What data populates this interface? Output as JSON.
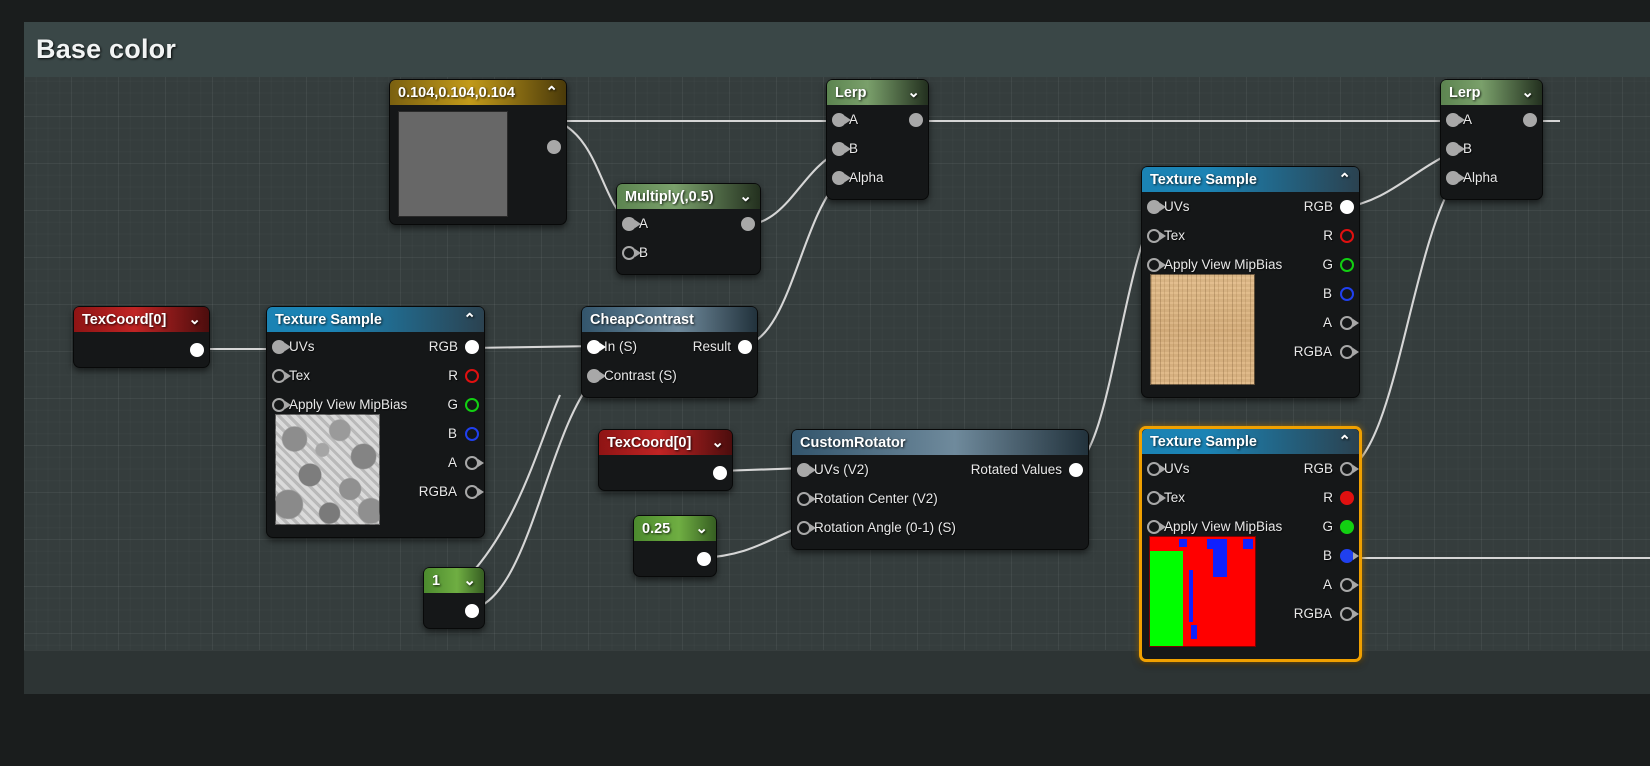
{
  "title_bar": {
    "label": "Base color"
  },
  "colors": {
    "canvas_bg": "#353d3d",
    "node_bg": "#151718",
    "selection": "#f0a000",
    "wire": "#d6d6d6",
    "pin_r": "#e01010",
    "pin_g": "#12d012",
    "pin_b": "#2040ef",
    "header_texture_sample": "#1b83b4",
    "header_lerp": "#7aa06b",
    "header_texcoord": "#c02424",
    "header_constant3": "#c29a1a",
    "header_constant": "#6fae42"
  },
  "nodes": {
    "constant3": {
      "title": "0.104,0.104,0.104",
      "chevron": "⌃",
      "swatch_color": "#676767",
      "output_label": ""
    },
    "multiply": {
      "title": "Multiply(,0.5)",
      "chevron": "⌄",
      "inputs": [
        "A",
        "B"
      ],
      "output_label": ""
    },
    "lerp_mid": {
      "title": "Lerp",
      "chevron": "⌄",
      "inputs": [
        "A",
        "B",
        "Alpha"
      ],
      "output_label": ""
    },
    "lerp_right": {
      "title": "Lerp",
      "chevron": "⌄",
      "inputs": [
        "A",
        "B",
        "Alpha"
      ],
      "output_label": ""
    },
    "texcoord_left": {
      "title": "TexCoord[0]",
      "chevron": "⌄"
    },
    "texcoord_mid": {
      "title": "TexCoord[0]",
      "chevron": "⌄"
    },
    "texture_sample_noise": {
      "title": "Texture Sample",
      "chevron": "⌃",
      "inputs": [
        "UVs",
        "Tex",
        "Apply View MipBias"
      ],
      "outputs": [
        "RGB",
        "R",
        "G",
        "B",
        "A",
        "RGBA"
      ],
      "preview": "grayscale-noise"
    },
    "texture_sample_wood": {
      "title": "Texture Sample",
      "chevron": "⌃",
      "inputs": [
        "UVs",
        "Tex",
        "Apply View MipBias"
      ],
      "outputs": [
        "RGB",
        "R",
        "G",
        "B",
        "A",
        "RGBA"
      ],
      "preview": "wood-grain"
    },
    "texture_sample_mask": {
      "title": "Texture Sample",
      "chevron": "⌃",
      "inputs": [
        "UVs",
        "Tex",
        "Apply View MipBias"
      ],
      "outputs": [
        "RGB",
        "R",
        "G",
        "B",
        "A",
        "RGBA"
      ],
      "preview": "rgb-mask",
      "selected": true
    },
    "cheap_contrast": {
      "title": "CheapContrast",
      "inputs": [
        "In (S)",
        "Contrast (S)"
      ],
      "outputs": [
        "Result"
      ]
    },
    "custom_rotator": {
      "title": "CustomRotator",
      "inputs": [
        "UVs (V2)",
        "Rotation Center (V2)",
        "Rotation Angle (0-1) (S)"
      ],
      "outputs": [
        "Rotated Values"
      ]
    },
    "const_025": {
      "title": "0.25",
      "chevron": "⌄"
    },
    "const_1": {
      "title": "1",
      "chevron": "⌄"
    }
  }
}
